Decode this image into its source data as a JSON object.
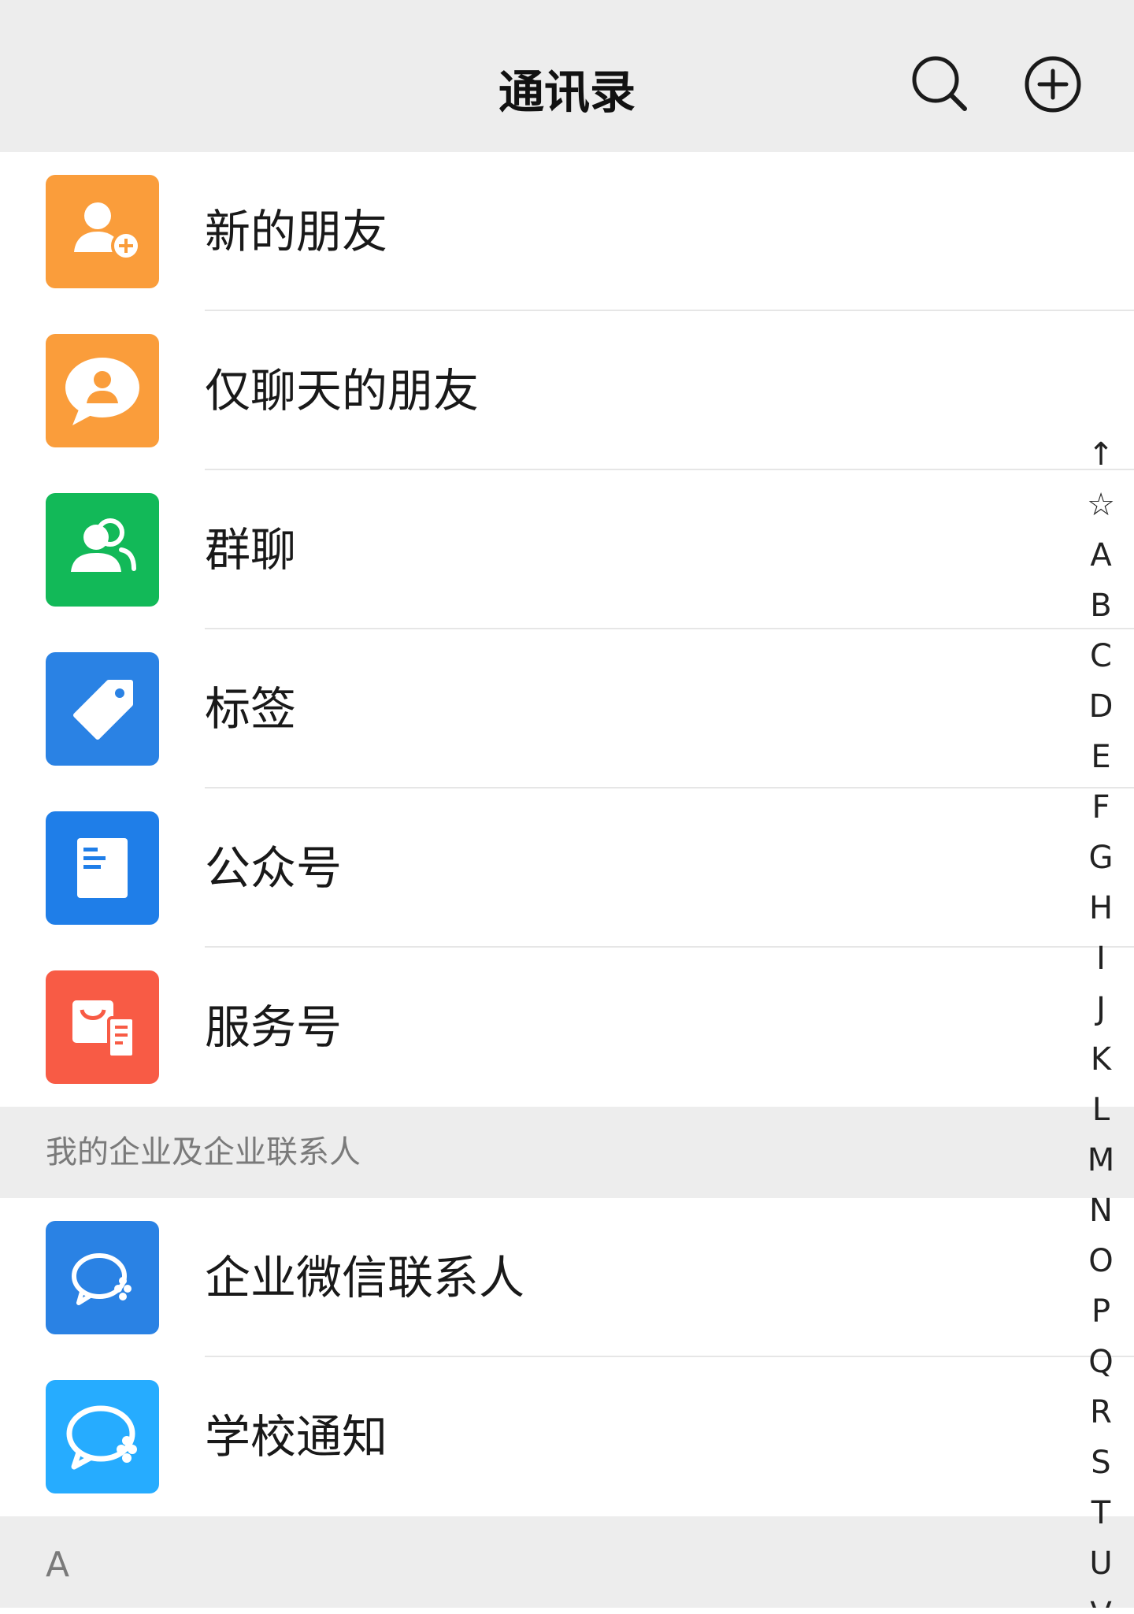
{
  "header": {
    "title": "通讯录",
    "search_icon": "search-icon",
    "add_icon": "add-circle-icon"
  },
  "entries": [
    {
      "label": "新的朋友",
      "icon": "new-friend-icon",
      "color": "#fa9d3b"
    },
    {
      "label": "仅聊天的朋友",
      "icon": "chat-only-friend-icon",
      "color": "#fa9d3b"
    },
    {
      "label": "群聊",
      "icon": "group-chat-icon",
      "color": "#12b958"
    },
    {
      "label": "标签",
      "icon": "tag-icon",
      "color": "#2a82e4"
    },
    {
      "label": "公众号",
      "icon": "official-account-icon",
      "color": "#1f7ee8"
    },
    {
      "label": "服务号",
      "icon": "service-account-icon",
      "color": "#f85b45"
    }
  ],
  "enterprise_section": {
    "title": "我的企业及企业联系人",
    "items": [
      {
        "label": "企业微信联系人",
        "icon": "wecom-contacts-icon",
        "color": "#2a82e4"
      },
      {
        "label": "学校通知",
        "icon": "school-notice-icon",
        "color": "#26acff"
      }
    ]
  },
  "letter_section": {
    "title": "A"
  },
  "index": [
    "↑",
    "☆",
    "A",
    "B",
    "C",
    "D",
    "E",
    "F",
    "G",
    "H",
    "I",
    "J",
    "K",
    "L",
    "M",
    "N",
    "O",
    "P",
    "Q",
    "R",
    "S",
    "T",
    "U",
    "V"
  ]
}
